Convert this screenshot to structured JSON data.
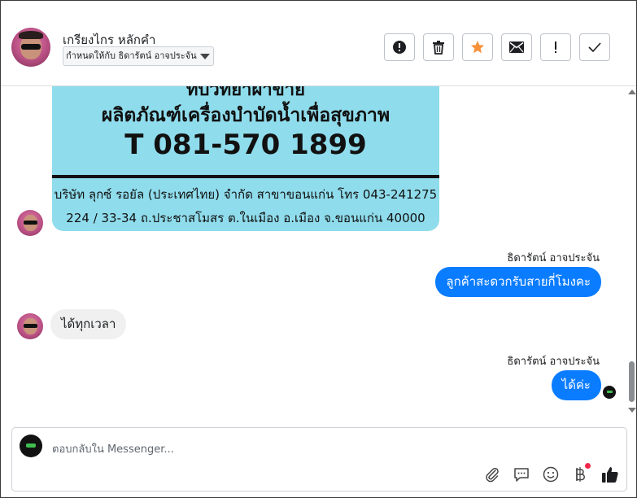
{
  "header": {
    "contact_name": "เกรียงไกร หลักคำ",
    "assign_label": "กำหนดให้กับ ธิดารัตน์ อาจประจัน",
    "toolbar": [
      {
        "name": "spam-button",
        "icon": "exclamation-circle-icon"
      },
      {
        "name": "delete-button",
        "icon": "trash-icon"
      },
      {
        "name": "star-button",
        "icon": "star-icon",
        "color": "#f7923b"
      },
      {
        "name": "mark-unread-button",
        "icon": "envelope-icon"
      },
      {
        "name": "follow-up-button",
        "icon": "exclamation-icon"
      },
      {
        "name": "mark-done-button",
        "icon": "check-icon"
      }
    ]
  },
  "image_message": {
    "lines": [
      "ทบวทยาผาขาย",
      "ผลิตภัณฑ์เครื่องบำบัดน้ำเพื่อสุขภาพ",
      "T 081-570 1899",
      "บริษัท ลุกซ์ รอยัล (ประเทศไทย) จำกัด สาขาขอนแก่น โทร 043-241275",
      "224 / 33-34 ถ.ประชาสโมสร ต.ในเมือง อ.เมือง จ.ขอนแก่น 40000"
    ]
  },
  "messages": [
    {
      "direction": "out",
      "sender": "ธิดารัตน์ อาจประจัน",
      "text": "ลูกค้าสะดวกรับสายกี่โมงคะ"
    },
    {
      "direction": "in",
      "text": "ได้ทุกเวลา"
    },
    {
      "direction": "out",
      "sender": "ธิดารัตน์ อาจประจัน",
      "text": "ได้ค่ะ"
    }
  ],
  "composer": {
    "placeholder": "ตอบกลับใน Messenger...",
    "icons": [
      "paperclip-icon",
      "chat-bubble-icon",
      "emoji-icon",
      "baht-icon",
      "thumbs-up-icon"
    ]
  },
  "colors": {
    "accent_blue": "#0a7cff",
    "star_orange": "#f7923b",
    "incoming_bubble": "#f0f0f0",
    "notification_dot": "#f0284a"
  }
}
